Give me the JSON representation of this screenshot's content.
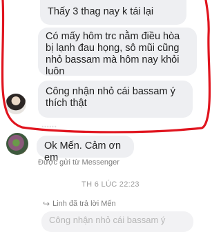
{
  "messages": {
    "m1": "Thấy 3 thag nay k tái lại",
    "m2": "Có mấy hôm trc nằm điều hòa bị lạnh đau họng, sô mũi cũng nhỏ bassam mà hôm nay khỏi luôn",
    "m3": "Công nhận nhỏ cái bassam ý thích thật",
    "reply": "Ok Mến. Cảm ơn em"
  },
  "sent_via": "Được gửi từ Messenger",
  "timestamp": "TH 6 LÚC 22:23",
  "reply_note": "Linh đã trả lời Mến",
  "reply_preview": "Công nhận nhỏ cái bassam ý",
  "colors": {
    "annotation": "#e0141e",
    "bubble": "#eeeff2"
  }
}
